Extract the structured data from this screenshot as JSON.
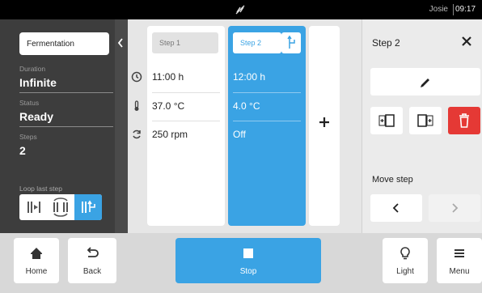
{
  "topbar": {
    "user": "Josie",
    "time": "09:17"
  },
  "left": {
    "program_name": "Fermentation",
    "duration_label": "Duration",
    "duration_value": "Infinite",
    "status_label": "Status",
    "status_value": "Ready",
    "steps_label": "Steps",
    "steps_value": "2",
    "loop_label": "Loop last step"
  },
  "steps": [
    {
      "name": "Step 1",
      "time": "11:00 h",
      "temp": "37.0 °C",
      "speed": "250 rpm"
    },
    {
      "name": "Step 2",
      "time": "12:00 h",
      "temp": "4.0 °C",
      "speed": "Off"
    }
  ],
  "right": {
    "title": "Step 2",
    "move_label": "Move step"
  },
  "bottom": {
    "home": "Home",
    "back": "Back",
    "stop": "Stop",
    "light": "Light",
    "menu": "Menu"
  },
  "colors": {
    "accent": "#3aa3e4",
    "danger": "#e53935",
    "dark_panel": "#3d3d3d"
  }
}
